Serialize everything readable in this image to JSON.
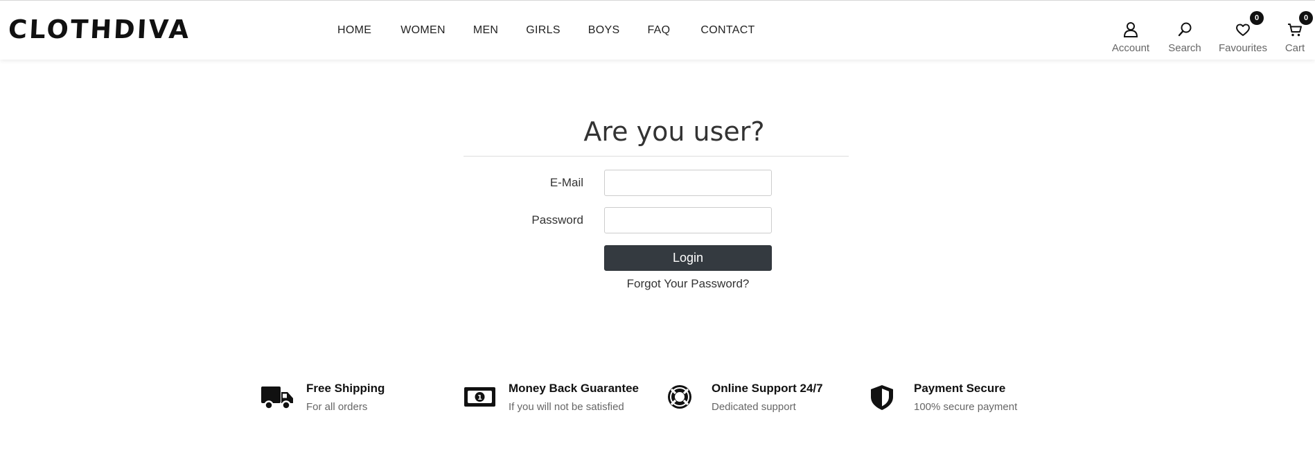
{
  "brand": {
    "logo": "CLOTHDIVA"
  },
  "nav": {
    "items": [
      {
        "label": "HOME"
      },
      {
        "label": "WOMEN"
      },
      {
        "label": "MEN"
      },
      {
        "label": "GIRLS"
      },
      {
        "label": "BOYS"
      },
      {
        "label": "FAQ"
      },
      {
        "label": "CONTACT"
      }
    ]
  },
  "header_actions": {
    "account": {
      "label": "Account",
      "icon": "user-icon"
    },
    "search": {
      "label": "Search",
      "icon": "search-icon"
    },
    "favourites": {
      "label": "Favourites",
      "icon": "heart-icon",
      "count": "0"
    },
    "cart": {
      "label": "Cart",
      "icon": "cart-icon",
      "count": "0"
    }
  },
  "login": {
    "title": "Are you user?",
    "email_label": "E-Mail",
    "email_value": "",
    "password_label": "Password",
    "password_value": "",
    "submit_label": "Login",
    "forgot_label": "Forgot Your Password?"
  },
  "features": [
    {
      "title": "Free Shipping",
      "subtitle": "For all orders",
      "icon": "truck-icon"
    },
    {
      "title": "Money Back Guarantee",
      "subtitle": "If you will not be satisfied",
      "icon": "money-icon"
    },
    {
      "title": "Online Support 24/7",
      "subtitle": "Dedicated support",
      "icon": "lifebuoy-icon"
    },
    {
      "title": "Payment Secure",
      "subtitle": "100% secure payment",
      "icon": "shield-icon"
    }
  ],
  "colors": {
    "button_bg": "#343a40",
    "badge_bg": "#111111",
    "text_muted": "#666666"
  }
}
